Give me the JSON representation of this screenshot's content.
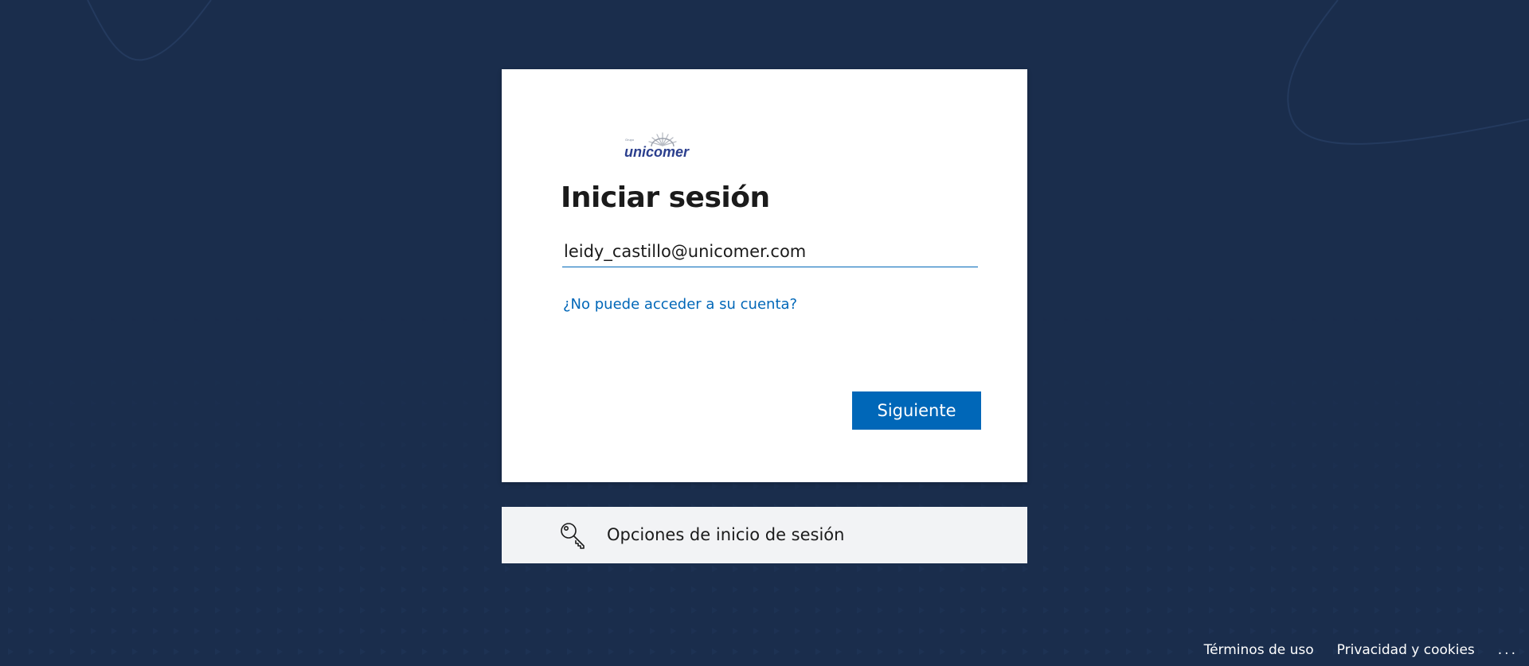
{
  "page": {
    "background_color": "#1a2d4c"
  },
  "brand": {
    "name": "unicomer",
    "tagline": "Grupo"
  },
  "signin": {
    "title": "Iniciar sesión",
    "email_value": "leidy_castillo@unicomer.com",
    "cant_access_link": "¿No puede acceder a su cuenta?",
    "next_button": "Siguiente",
    "accent_color": "#0067b8"
  },
  "signin_options": {
    "icon": "key-icon",
    "label": "Opciones de inicio de sesión"
  },
  "footer": {
    "terms": "Términos de uso",
    "privacy": "Privacidad y cookies",
    "more": "..."
  }
}
